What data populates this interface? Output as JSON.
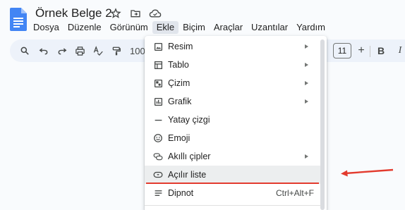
{
  "document": {
    "title": "Örnek Belge 2"
  },
  "title_icons": [
    "star-icon",
    "move-to-folder-icon",
    "cloud-saved-icon"
  ],
  "menubar": {
    "items": [
      "Dosya",
      "Düzenle",
      "Görünüm",
      "Ekle",
      "Biçim",
      "Araçlar",
      "Uzantılar",
      "Yardım"
    ],
    "active": "Ekle"
  },
  "toolbar": {
    "zoom": "100%",
    "font_size": "11",
    "plus": "+",
    "bold": "B",
    "italic": "I"
  },
  "insert_menu": {
    "items": [
      {
        "label": "Resim",
        "icon": "image-icon",
        "submenu": true
      },
      {
        "label": "Tablo",
        "icon": "table-icon",
        "submenu": true
      },
      {
        "label": "Çizim",
        "icon": "drawing-icon",
        "submenu": true
      },
      {
        "label": "Grafik",
        "icon": "chart-icon",
        "submenu": true
      },
      {
        "label": "Yatay çizgi",
        "icon": "horizontal-line-icon",
        "submenu": false
      },
      {
        "label": "Emoji",
        "icon": "emoji-icon",
        "submenu": false
      },
      {
        "label": "Akıllı çipler",
        "icon": "smart-chips-icon",
        "submenu": true
      },
      {
        "label": "Açılır liste",
        "icon": "dropdown-icon",
        "submenu": false,
        "highlighted": true
      },
      {
        "label": "Dipnot",
        "icon": "footnote-icon",
        "submenu": false,
        "shortcut": "Ctrl+Alt+F"
      }
    ]
  },
  "colors": {
    "doc_icon": "#4285f4",
    "annotation_red": "#e33b2e",
    "toolbar_bg": "#edf2fa",
    "menu_highlight": "#eceeef"
  }
}
